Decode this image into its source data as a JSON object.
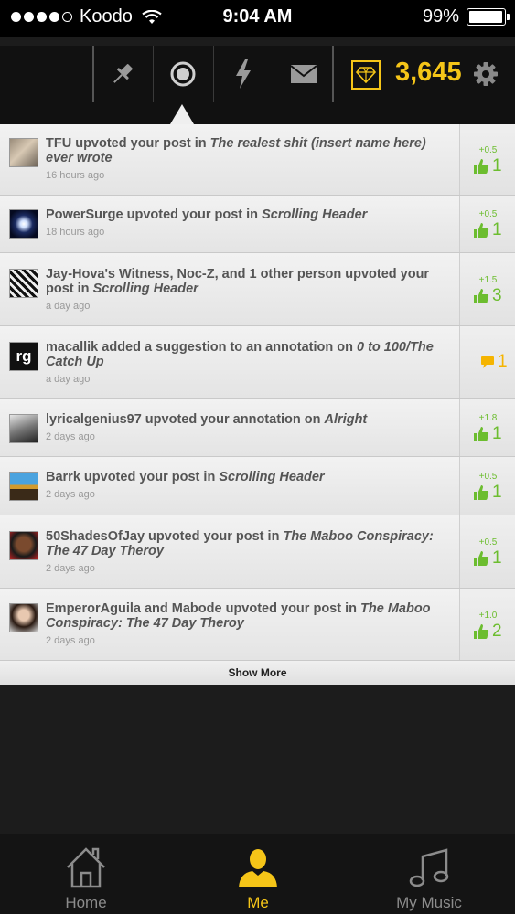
{
  "status_bar": {
    "carrier": "Koodo",
    "time": "9:04 AM",
    "battery": "99%"
  },
  "header": {
    "iq": "3,645",
    "icons": [
      "pin-icon",
      "record-icon",
      "lightning-icon",
      "mail-icon"
    ]
  },
  "feed": [
    {
      "actor": "TFU",
      "action": " upvoted your post in ",
      "target": "The realest shit (insert name here) ever wrote",
      "time": "16 hours ago",
      "delta": "+0.5",
      "count": "1",
      "kind": "upvote"
    },
    {
      "actor": "PowerSurge",
      "action": " upvoted your post in ",
      "target": "Scrolling Header",
      "time": "18 hours ago",
      "delta": "+0.5",
      "count": "1",
      "kind": "upvote"
    },
    {
      "actor": "Jay-Hova's Witness, Noc-Z, and 1 other person",
      "action": " upvoted your post in ",
      "target": "Scrolling Header",
      "time": "a day ago",
      "delta": "+1.5",
      "count": "3",
      "kind": "upvote"
    },
    {
      "actor": "macallik",
      "action": " added a suggestion to an annotation on ",
      "target": "0 to 100/The Catch Up",
      "time": "a day ago",
      "delta": "",
      "count": "1",
      "kind": "comment"
    },
    {
      "actor": "lyricalgenius97",
      "action": " upvoted your annotation on ",
      "target": "Alright",
      "time": "2 days ago",
      "delta": "+1.8",
      "count": "1",
      "kind": "upvote"
    },
    {
      "actor": "Barrk",
      "action": " upvoted your post in ",
      "target": "Scrolling Header",
      "time": "2 days ago",
      "delta": "+0.5",
      "count": "1",
      "kind": "upvote"
    },
    {
      "actor": "50ShadesOfJay",
      "action": " upvoted your post in ",
      "target": "The Maboo Conspiracy: The 47 Day Theroy",
      "time": "2 days ago",
      "delta": "+0.5",
      "count": "1",
      "kind": "upvote"
    },
    {
      "actor": "EmperorAguila and Mabode",
      "action": " upvoted your post in ",
      "target": "The Maboo Conspiracy: The 47 Day Theroy",
      "time": "2 days ago",
      "delta": "+1.0",
      "count": "2",
      "kind": "upvote"
    }
  ],
  "show_more": "Show More",
  "tabs": [
    {
      "label": "Home",
      "icon": "home-icon",
      "active": false
    },
    {
      "label": "Me",
      "icon": "person-icon",
      "active": true
    },
    {
      "label": "My Music",
      "icon": "music-note-icon",
      "active": false
    }
  ],
  "colors": {
    "accent": "#f5c518",
    "upvote": "#6cbd2f",
    "comment": "#f5b400"
  }
}
